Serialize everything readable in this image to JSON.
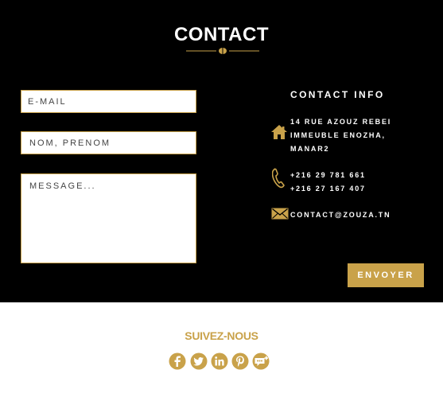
{
  "contact": {
    "title": "CONTACT",
    "email_placeholder": "E-MAIL",
    "name_placeholder": "NOM, PRENOM",
    "message_placeholder": "MESSAGE...",
    "send_label": "ENVOYER"
  },
  "info": {
    "title": "CONTACT INFO",
    "address_lines": [
      "14 RUE AZOUZ REBEI",
      "IMMEUBLE ENOZHA,",
      "MANAR2"
    ],
    "phones": [
      "+216 29 781 661",
      "+216 27 167 407"
    ],
    "email": "CONTACT@ZOUZA.TN"
  },
  "footer": {
    "follow_label": "SUIVEZ-NOUS",
    "social_icons": [
      "facebook-icon",
      "twitter-icon",
      "linkedin-icon",
      "pinterest-icon",
      "google-plus-icon"
    ]
  },
  "colors": {
    "accent": "#c9a24a",
    "background_dark": "#000000",
    "background_light": "#ffffff"
  }
}
